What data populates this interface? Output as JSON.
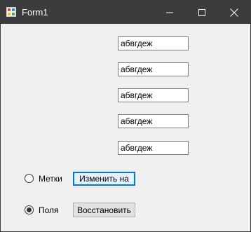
{
  "window": {
    "title": "Form1"
  },
  "textboxes": [
    {
      "value": "абвгдеж"
    },
    {
      "value": "абвгдеж"
    },
    {
      "value": "абвгдеж"
    },
    {
      "value": "абвгдеж"
    },
    {
      "value": "абвгдеж"
    }
  ],
  "radios": [
    {
      "label": "Метки",
      "checked": false
    },
    {
      "label": "Поля",
      "checked": true
    }
  ],
  "buttons": {
    "change_label": "Изменить на",
    "restore_label": "Восстановить"
  },
  "colors": {
    "titlebar": "#3c3c3c",
    "form_background": "#f0f0f0",
    "focus_accent": "#0078d7"
  },
  "icons": {
    "app": "winforms-app-icon",
    "minimize": "minimize-icon",
    "maximize": "maximize-icon",
    "close": "close-icon"
  }
}
